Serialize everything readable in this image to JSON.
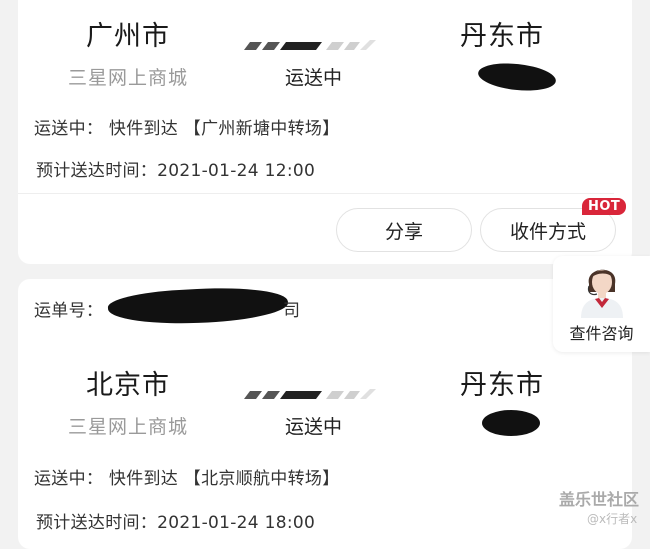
{
  "shipments": [
    {
      "from_city": "广州市",
      "to_city": "丹东市",
      "seller": "三星网上商城",
      "status": "运送中",
      "detail": "运送中：  快件到达 【广州新塘中转场】",
      "eta": "预计送达时间：2021-01-24 12:00",
      "buttons": {
        "share": "分享",
        "receive": "收件方式"
      },
      "hot_badge": "HOT"
    },
    {
      "tracking_label": "运单号：",
      "tracking_suffix": "司",
      "from_city": "北京市",
      "to_city": "丹东市",
      "seller": "三星网上商城",
      "status": "运送中",
      "detail": "运送中：  快件到达 【北京顺航中转场】",
      "eta": "预计送达时间：2021-01-24 18:00"
    }
  ],
  "service": {
    "label": "查件咨询",
    "icon": "customer-service-avatar-icon"
  },
  "watermark": {
    "main": "盖乐世社区",
    "sub": "@x行者x"
  },
  "colors": {
    "hot": "#d9263a",
    "progress_dark": "#333333",
    "progress_light": "#d8d8d8"
  }
}
